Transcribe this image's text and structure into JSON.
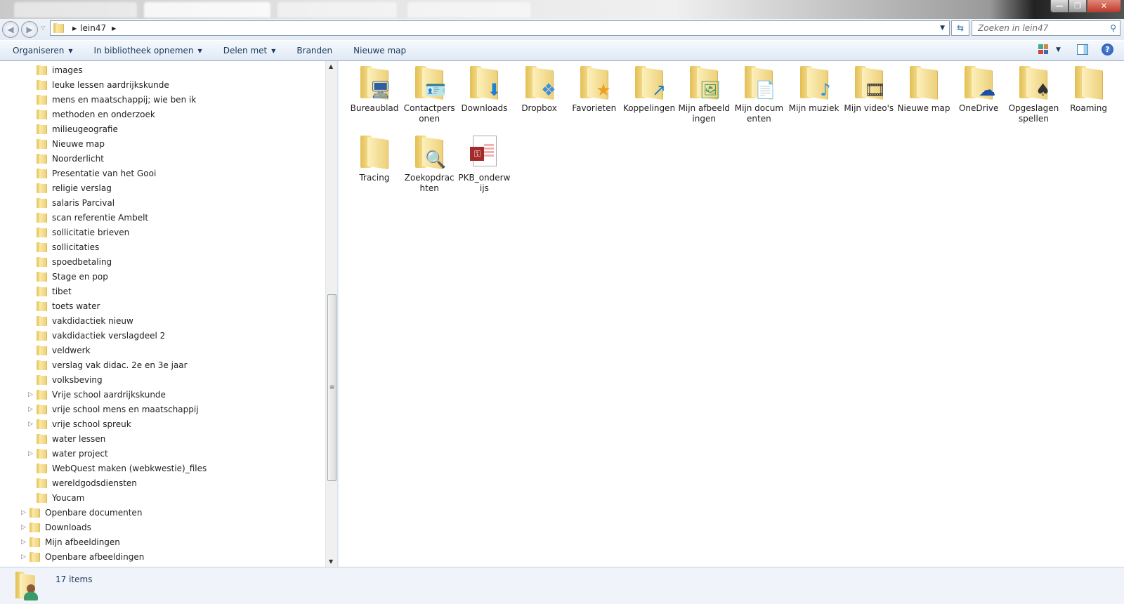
{
  "window": {
    "minimize": "—",
    "restore": "❐",
    "close": "✕"
  },
  "nav": {
    "back": "◀",
    "forward": "▶",
    "path": [
      "lein47"
    ],
    "search_placeholder": "Zoeken in lein47"
  },
  "toolbar": {
    "items": [
      {
        "label": "Organiseren",
        "dropdown": true
      },
      {
        "label": "In bibliotheek opnemen",
        "dropdown": true
      },
      {
        "label": "Delen met",
        "dropdown": true
      },
      {
        "label": "Branden",
        "dropdown": false
      },
      {
        "label": "Nieuwe map",
        "dropdown": false
      }
    ]
  },
  "sidebar": {
    "items": [
      {
        "label": "images",
        "level": 2,
        "expandable": false
      },
      {
        "label": "leuke lessen aardrijkskunde",
        "level": 2,
        "expandable": false
      },
      {
        "label": "mens en maatschappij; wie ben ik",
        "level": 2,
        "expandable": false
      },
      {
        "label": "methoden en onderzoek",
        "level": 2,
        "expandable": false
      },
      {
        "label": "milieugeografie",
        "level": 2,
        "expandable": false
      },
      {
        "label": "Nieuwe map",
        "level": 2,
        "expandable": false
      },
      {
        "label": "Noorderlicht",
        "level": 2,
        "expandable": false
      },
      {
        "label": "Presentatie van het Gooi",
        "level": 2,
        "expandable": false
      },
      {
        "label": "religie verslag",
        "level": 2,
        "expandable": false
      },
      {
        "label": "salaris Parcival",
        "level": 2,
        "expandable": false
      },
      {
        "label": "scan referentie Ambelt",
        "level": 2,
        "expandable": false
      },
      {
        "label": "sollicitatie brieven",
        "level": 2,
        "expandable": false
      },
      {
        "label": "sollicitaties",
        "level": 2,
        "expandable": false
      },
      {
        "label": "spoedbetaling",
        "level": 2,
        "expandable": false
      },
      {
        "label": "Stage en pop",
        "level": 2,
        "expandable": false
      },
      {
        "label": "tibet",
        "level": 2,
        "expandable": false
      },
      {
        "label": "toets water",
        "level": 2,
        "expandable": false
      },
      {
        "label": "vakdidactiek nieuw",
        "level": 2,
        "expandable": false
      },
      {
        "label": "vakdidactiek verslagdeel 2",
        "level": 2,
        "expandable": false
      },
      {
        "label": "veldwerk",
        "level": 2,
        "expandable": false
      },
      {
        "label": "verslag vak didac. 2e en 3e jaar",
        "level": 2,
        "expandable": false
      },
      {
        "label": "volksbeving",
        "level": 2,
        "expandable": false
      },
      {
        "label": "Vrije school aardrijkskunde",
        "level": 2,
        "expandable": true
      },
      {
        "label": "vrije school mens en maatschappij",
        "level": 2,
        "expandable": true
      },
      {
        "label": "vrije school spreuk",
        "level": 2,
        "expandable": true
      },
      {
        "label": "water lessen",
        "level": 2,
        "expandable": false
      },
      {
        "label": "water project",
        "level": 2,
        "expandable": true
      },
      {
        "label": "WebQuest maken (webkwestie)_files",
        "level": 2,
        "expandable": false
      },
      {
        "label": "wereldgodsdiensten",
        "level": 2,
        "expandable": false
      },
      {
        "label": "Youcam",
        "level": 2,
        "expandable": false
      },
      {
        "label": "Openbare documenten",
        "level": 1,
        "expandable": true
      },
      {
        "label": "Downloads",
        "level": 1,
        "expandable": true
      },
      {
        "label": "Mijn afbeeldingen",
        "level": 1,
        "expandable": true
      },
      {
        "label": "Openbare afbeeldingen",
        "level": 1,
        "expandable": true
      }
    ]
  },
  "content": {
    "items": [
      {
        "label": "Bureaublad",
        "icon": "desktop",
        "glyph": "🖥"
      },
      {
        "label": "Contactpersonen",
        "icon": "contacts",
        "glyph": "🪪"
      },
      {
        "label": "Downloads",
        "icon": "download",
        "glyph": "⬇"
      },
      {
        "label": "Dropbox",
        "icon": "dropbox",
        "glyph": "❖"
      },
      {
        "label": "Favorieten",
        "icon": "star",
        "glyph": "★"
      },
      {
        "label": "Koppelingen",
        "icon": "link",
        "glyph": "↗"
      },
      {
        "label": "Mijn afbeeldingen",
        "icon": "pictures",
        "glyph": "🖼"
      },
      {
        "label": "Mijn documenten",
        "icon": "documents",
        "glyph": "📄"
      },
      {
        "label": "Mijn muziek",
        "icon": "music",
        "glyph": "♪"
      },
      {
        "label": "Mijn video's",
        "icon": "video",
        "glyph": "🎞"
      },
      {
        "label": "Nieuwe map",
        "icon": "folder",
        "glyph": ""
      },
      {
        "label": "OneDrive",
        "icon": "cloud",
        "glyph": "☁"
      },
      {
        "label": "Opgeslagen spellen",
        "icon": "games",
        "glyph": "♠"
      },
      {
        "label": "Roaming",
        "icon": "folder",
        "glyph": ""
      },
      {
        "label": "Tracing",
        "icon": "folder",
        "glyph": ""
      },
      {
        "label": "Zoekopdrachten",
        "icon": "search",
        "glyph": "🔍"
      },
      {
        "label": "PKB_onderwijs",
        "icon": "access-db",
        "glyph": "🔑"
      }
    ]
  },
  "status": {
    "count": "17 items"
  },
  "colors": {
    "toolbar_text": "#1e395b",
    "accent": "#3c7fb1"
  }
}
